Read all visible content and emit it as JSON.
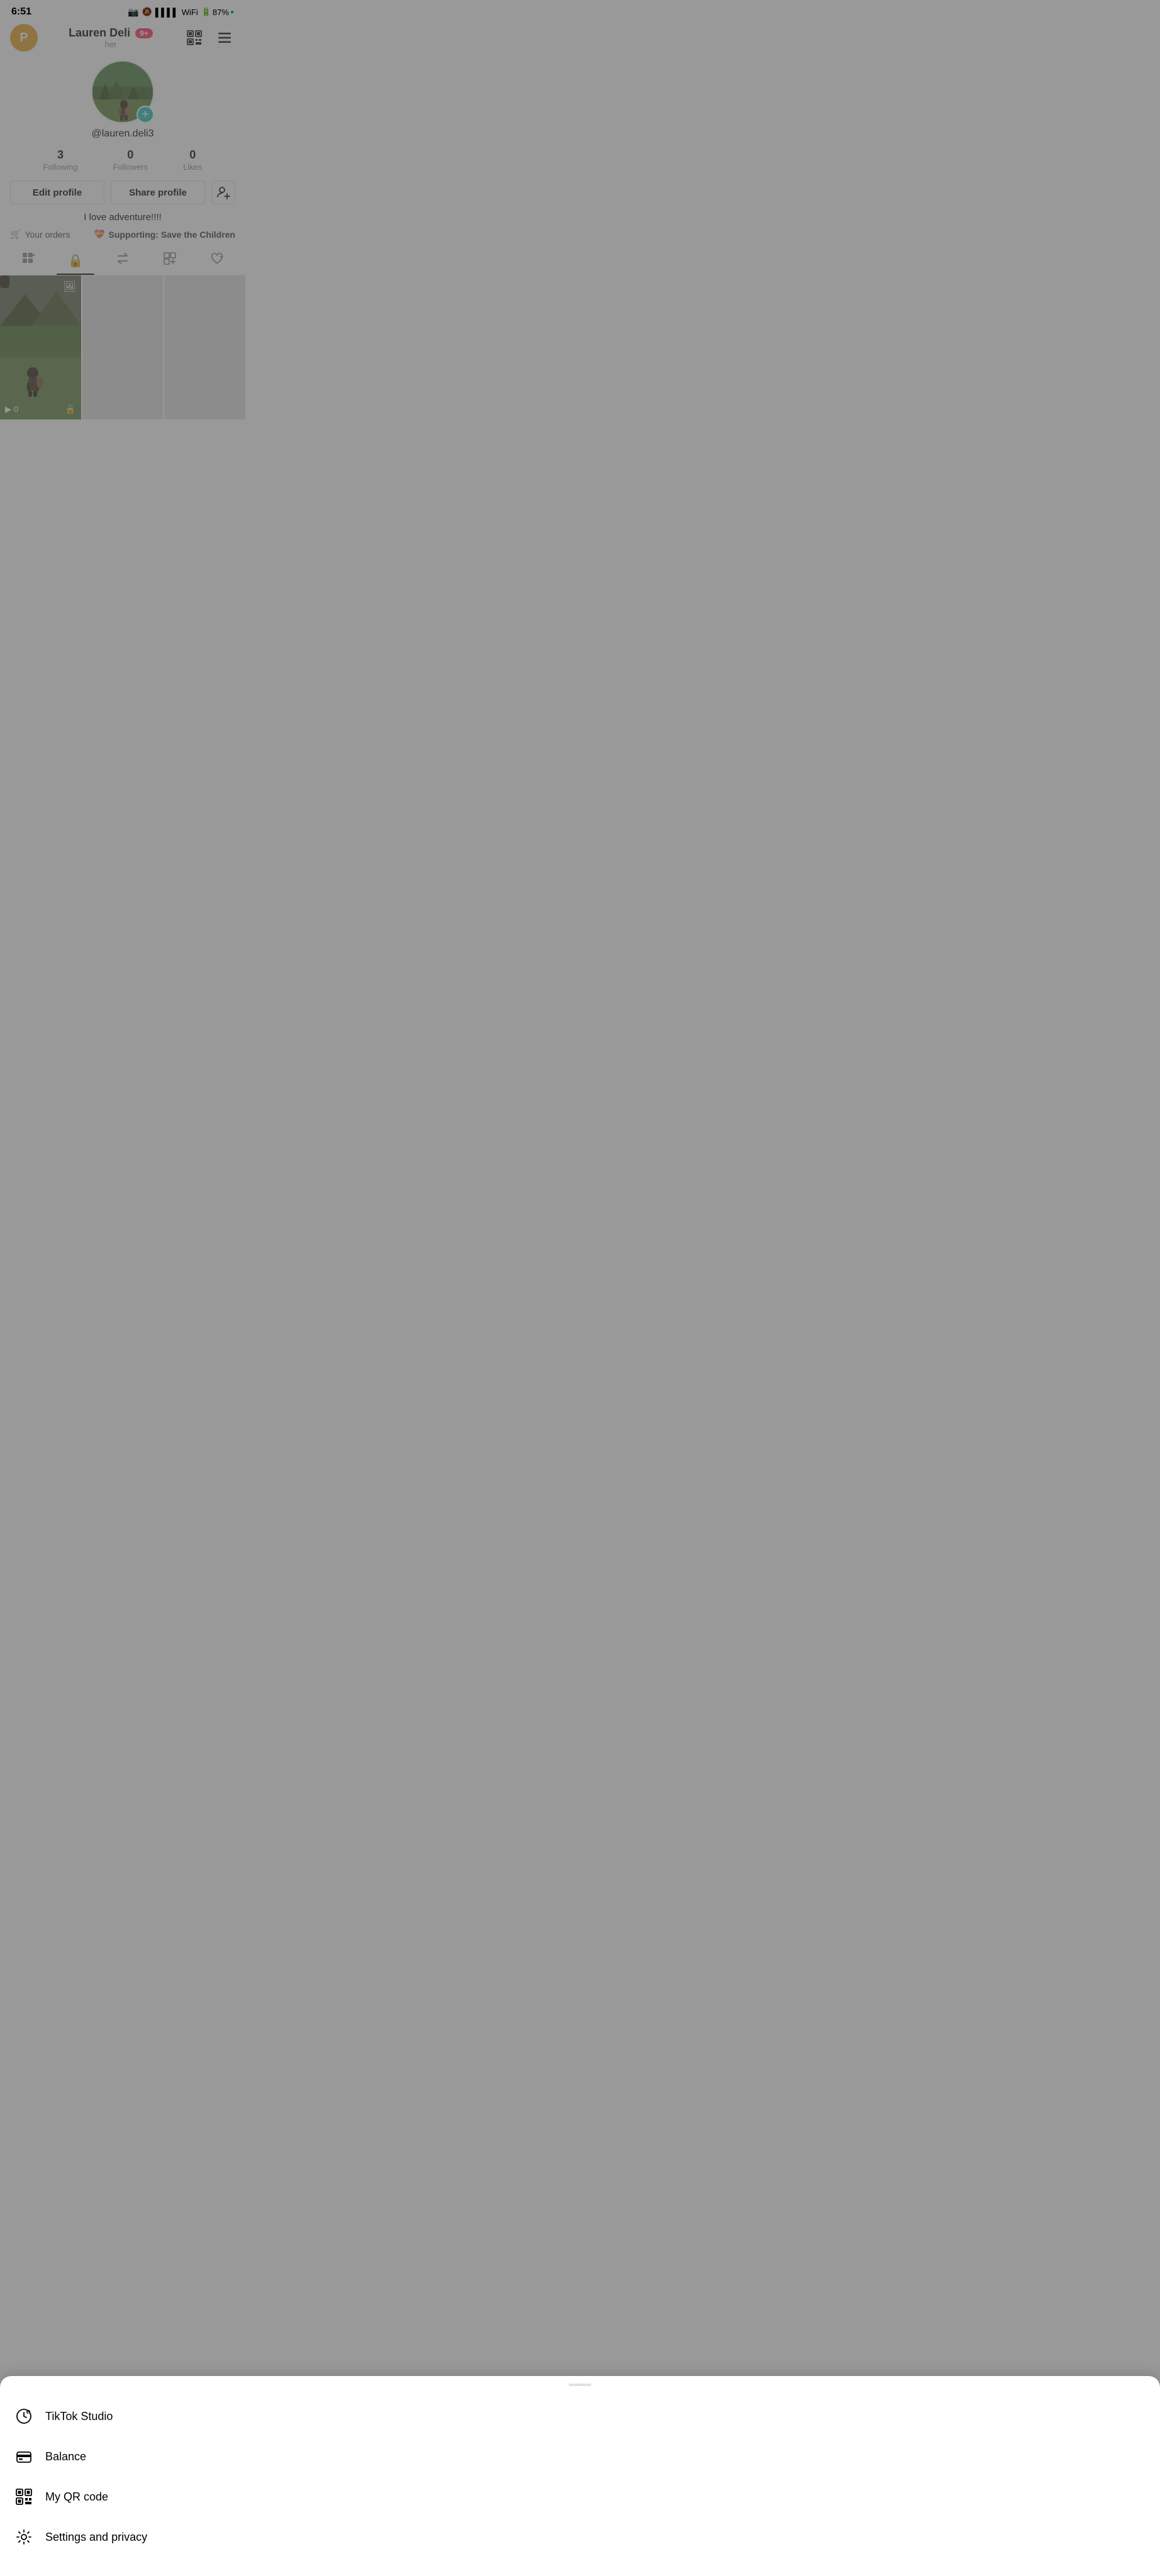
{
  "statusBar": {
    "time": "6:51",
    "battery": "87%",
    "batteryDot": "●"
  },
  "header": {
    "avatarInitial": "P",
    "username": "Lauren Deli",
    "notificationCount": "9+",
    "pronoun": "her",
    "qrIcon": "𝟡",
    "menuIcon": "☰"
  },
  "profile": {
    "handle": "@lauren.deli3",
    "plusBtn": "+",
    "stats": [
      {
        "number": "3",
        "label": "Following"
      },
      {
        "number": "0",
        "label": "Followers"
      },
      {
        "number": "0",
        "label": "Likes"
      }
    ],
    "editProfileLabel": "Edit profile",
    "shareProfileLabel": "Share profile",
    "bio": "I love adventure!!!!",
    "orders": "Your orders",
    "supporting": "Supporting: Save the Children"
  },
  "tabs": [
    {
      "id": "grid",
      "icon": "⊞",
      "active": false,
      "label": "Grid"
    },
    {
      "id": "locked",
      "icon": "🔒",
      "active": true,
      "label": "Locked"
    },
    {
      "id": "repost",
      "icon": "↺",
      "active": false,
      "label": "Repost"
    },
    {
      "id": "tagged",
      "icon": "🏷",
      "active": false,
      "label": "Tagged"
    },
    {
      "id": "liked",
      "icon": "♡",
      "active": false,
      "label": "Liked"
    }
  ],
  "videos": [
    {
      "hasContent": true,
      "playCount": "0",
      "locked": true,
      "imageIcon": true
    }
  ],
  "bottomSheet": {
    "handle": true,
    "items": [
      {
        "id": "tiktok-studio",
        "icon": "studio",
        "label": "TikTok Studio"
      },
      {
        "id": "balance",
        "icon": "wallet",
        "label": "Balance"
      },
      {
        "id": "qr-code",
        "icon": "qr",
        "label": "My QR code"
      },
      {
        "id": "settings",
        "icon": "gear",
        "label": "Settings and privacy"
      }
    ]
  },
  "colors": {
    "accent": "#20c0b0",
    "badgeRed": "#ff2d55",
    "avatarBg": "#e8a020"
  }
}
